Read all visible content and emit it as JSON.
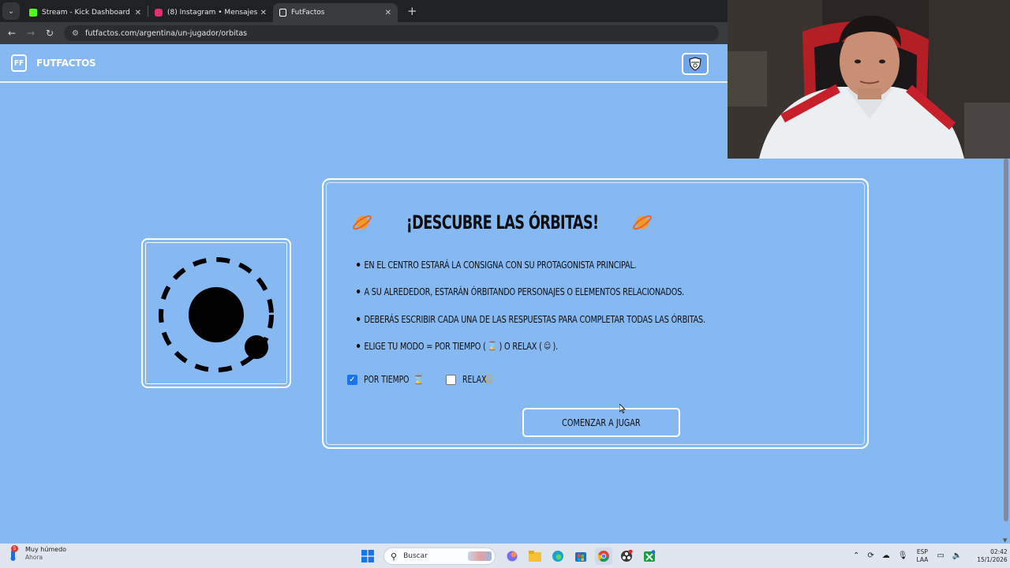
{
  "browser": {
    "tabs": [
      {
        "title": "Stream - Kick Dashboard",
        "favicon_color": "#53fc18",
        "active": false
      },
      {
        "title": "(8) Instagram • Mensajes",
        "favicon_color": "#e1306c",
        "active": false
      },
      {
        "title": "FutFactos",
        "favicon_color": "#ffffff",
        "active": true
      }
    ],
    "url": "futfactos.com/argentina/un-jugador/orbitas"
  },
  "header": {
    "logo_mark": "FF",
    "logo_text": "FUTFACTOS"
  },
  "card": {
    "title": "¡DESCUBRE LAS ÓRBITAS!",
    "rules": [
      "EN EL CENTRO ESTARÁ LA CONSIGNA CON SU PROTAGONISTA PRINCIPAL.",
      "A SU ALREDEDOR, ESTARÁN ÓRBITANDO PERSONAJES O ELEMENTOS RELACIONADOS.",
      "DEBERÁS ESCRIBIR CADA UNA DE LAS RESPUESTAS PARA COMPLETAR TODAS LAS ÓRBITAS."
    ],
    "mode_rule_prefix": "ELIGE TU MODO = POR TIEMPO (",
    "mode_rule_middle": ") O RELAX (",
    "mode_rule_suffix": ").",
    "modes": [
      {
        "label": "POR TIEMPO",
        "checked": true
      },
      {
        "label": "RELAX",
        "checked": false
      }
    ],
    "start_button": "COMENZAR A JUGAR"
  },
  "taskbar": {
    "weather_badge": "5",
    "weather_title": "Muy húmedo",
    "weather_sub": "Ahora",
    "search_placeholder": "Buscar",
    "lang_line1": "ESP",
    "lang_line2": "LAA",
    "time": "02:42",
    "date": "15/1/2026"
  },
  "colors": {
    "page_bg": "#86b8f2",
    "accent": "#1a73e8"
  }
}
